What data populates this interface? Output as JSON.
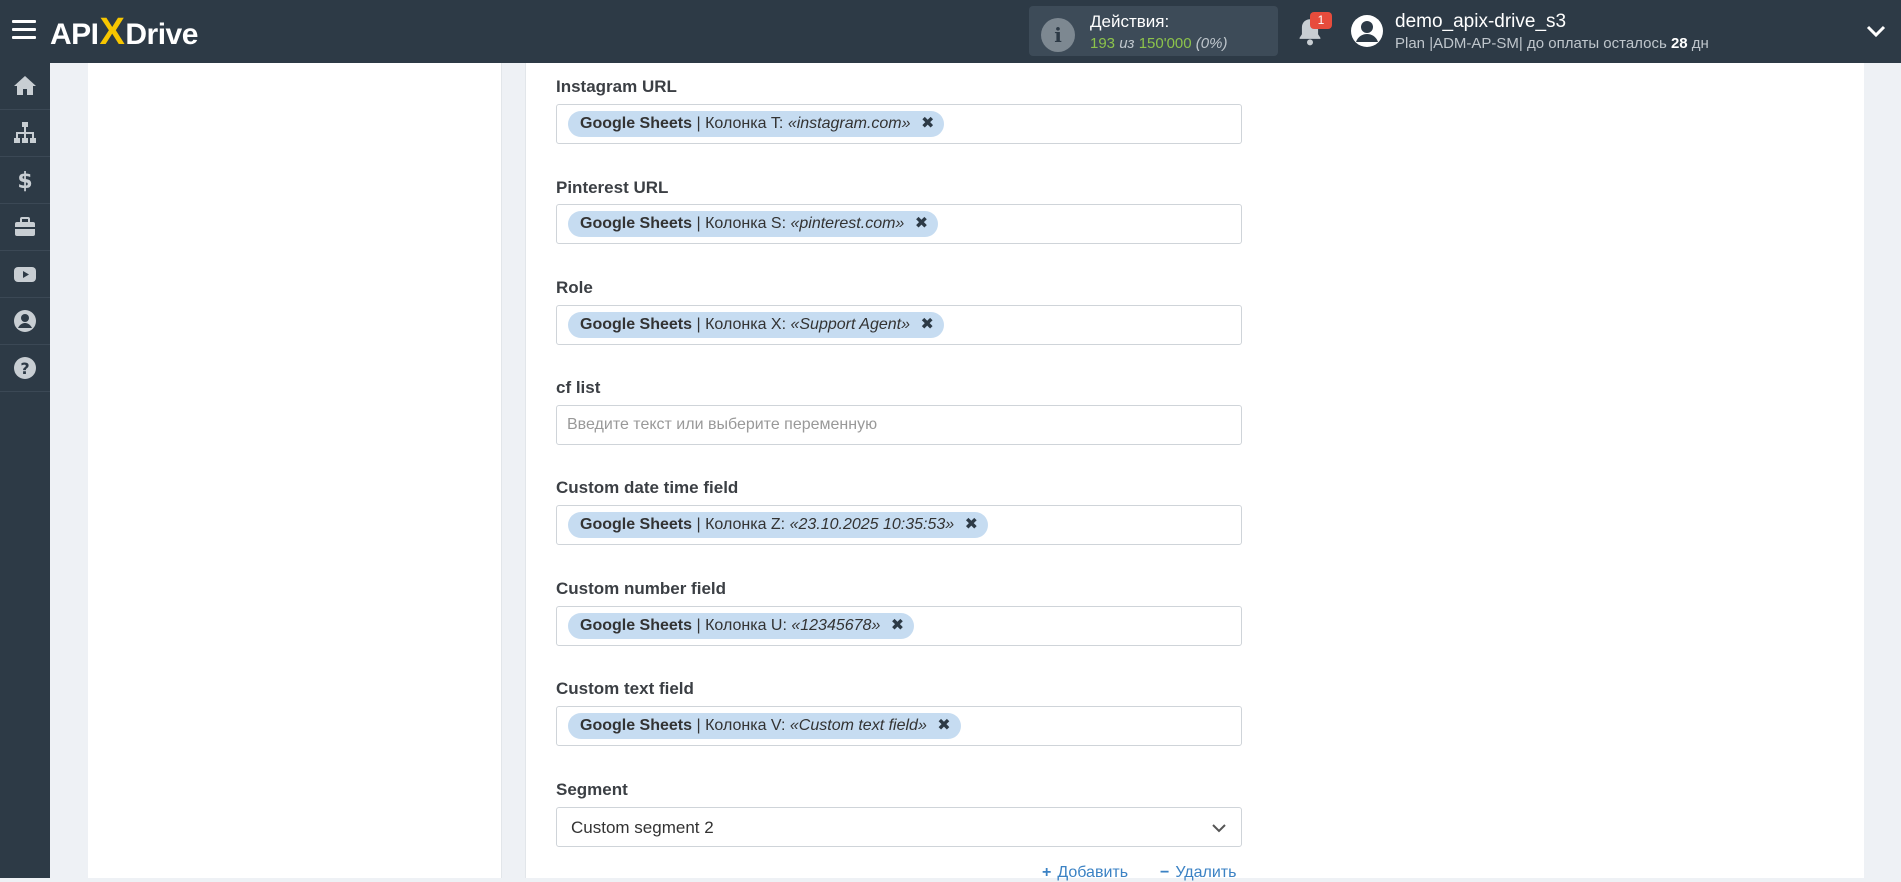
{
  "header": {
    "logo": {
      "api": "API",
      "x": "X",
      "drive": "Drive"
    },
    "actions": {
      "label": "Действия:",
      "used": "193",
      "of_word": "из",
      "limit": "150'000",
      "percent": "(0%)"
    },
    "notifications_count": "1",
    "user": {
      "name": "demo_apix-drive_s3",
      "plan_prefix": "Plan |ADM-AP-SM| до оплаты осталось",
      "days": "28",
      "days_unit": "дн"
    }
  },
  "sidenav": {
    "items": [
      "home-icon",
      "sitemap-icon",
      "dollar-icon",
      "briefcase-icon",
      "youtube-icon",
      "user-circle-icon",
      "question-circle-icon"
    ]
  },
  "fields": [
    {
      "label": "Instagram URL",
      "chip": {
        "source": "Google Sheets",
        "column": "Колонка T:",
        "example": "«instagram.com»"
      }
    },
    {
      "label": "Pinterest URL",
      "chip": {
        "source": "Google Sheets",
        "column": "Колонка S:",
        "example": "«pinterest.com»"
      }
    },
    {
      "label": "Role",
      "chip": {
        "source": "Google Sheets",
        "column": "Колонка X:",
        "example": "«Support Agent»"
      }
    },
    {
      "label": "cf list",
      "placeholder": "Введите текст или выберите переменную"
    },
    {
      "label": "Custom date time field",
      "chip": {
        "source": "Google Sheets",
        "column": "Колонка Z:",
        "example": "«23.10.2025 10:35:53»"
      }
    },
    {
      "label": "Custom number field",
      "chip": {
        "source": "Google Sheets",
        "column": "Колонка U:",
        "example": "«12345678»"
      }
    },
    {
      "label": "Custom text field",
      "chip": {
        "source": "Google Sheets",
        "column": "Колонка V:",
        "example": "«Custom text field»"
      }
    },
    {
      "label": "Segment",
      "select_value": "Custom segment 2"
    }
  ],
  "links": {
    "add": {
      "symbol": "+",
      "label": "Добавить"
    },
    "remove": {
      "symbol": "−",
      "label": "Удалить"
    }
  },
  "colors": {
    "topbar": "#2d3a46",
    "chip_bg": "#c6dcf1",
    "link": "#3b82c4",
    "accent_yellow": "#f7c600",
    "badge": "#e74c3c"
  }
}
